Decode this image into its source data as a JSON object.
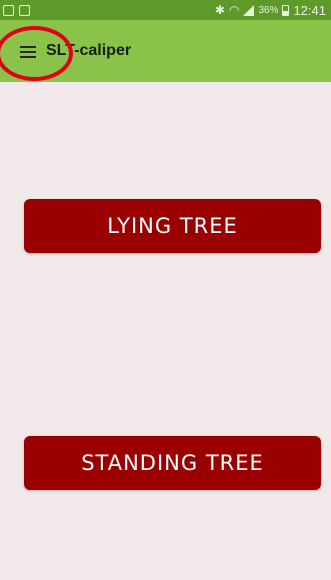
{
  "status_bar": {
    "battery_percent": "36%",
    "time": "12:41",
    "icons": [
      "notification-icon",
      "notification-icon",
      "bluetooth-icon",
      "wifi-icon",
      "signal-icon",
      "battery-icon"
    ]
  },
  "toolbar": {
    "title": "SLT-caliper",
    "menu_icon": "hamburger-menu-icon"
  },
  "main": {
    "lying_tree_label": "LYING TREE",
    "standing_tree_label": "STANDING TREE"
  },
  "colors": {
    "status_bar": "#5d9a2a",
    "toolbar": "#8bc34a",
    "background": "#f1e9e9",
    "button": "#9b0000",
    "highlight": "#e0001b"
  }
}
